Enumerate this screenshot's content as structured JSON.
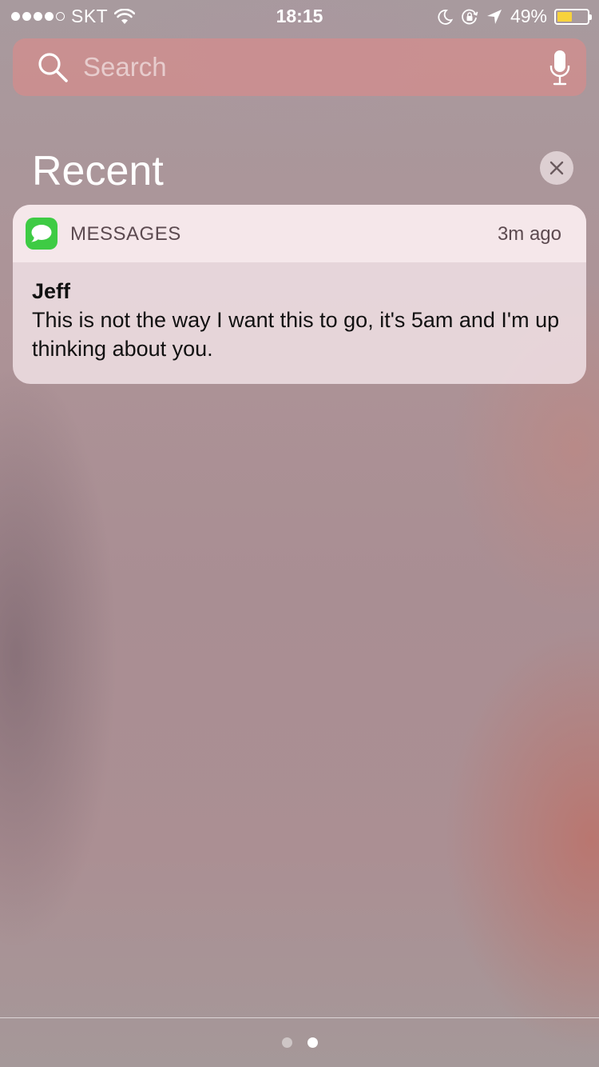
{
  "status_bar": {
    "carrier": "SKT",
    "signal_bars": 4,
    "signal_max": 5,
    "time": "18:15",
    "battery_percent": "49%",
    "battery_level": 0.49,
    "icons": [
      "wifi-icon",
      "moon-icon",
      "rotation-lock-icon",
      "location-arrow-icon",
      "battery-icon"
    ],
    "battery_color": "#f7d23c"
  },
  "search": {
    "placeholder": "Search",
    "value": "",
    "icon": "search-icon",
    "mic_icon": "microphone-icon"
  },
  "recent": {
    "title": "Recent",
    "clear_icon": "close-icon"
  },
  "notification": {
    "app_name": "MESSAGES",
    "app_icon": "messages-bubble-icon",
    "app_color": "#3ecb44",
    "time": "3m ago",
    "sender": "Jeff",
    "message": "This is not the way I want this to go, it's 5am and I'm up thinking about you."
  },
  "page_indicator": {
    "pages": 2,
    "current_page": 2
  }
}
